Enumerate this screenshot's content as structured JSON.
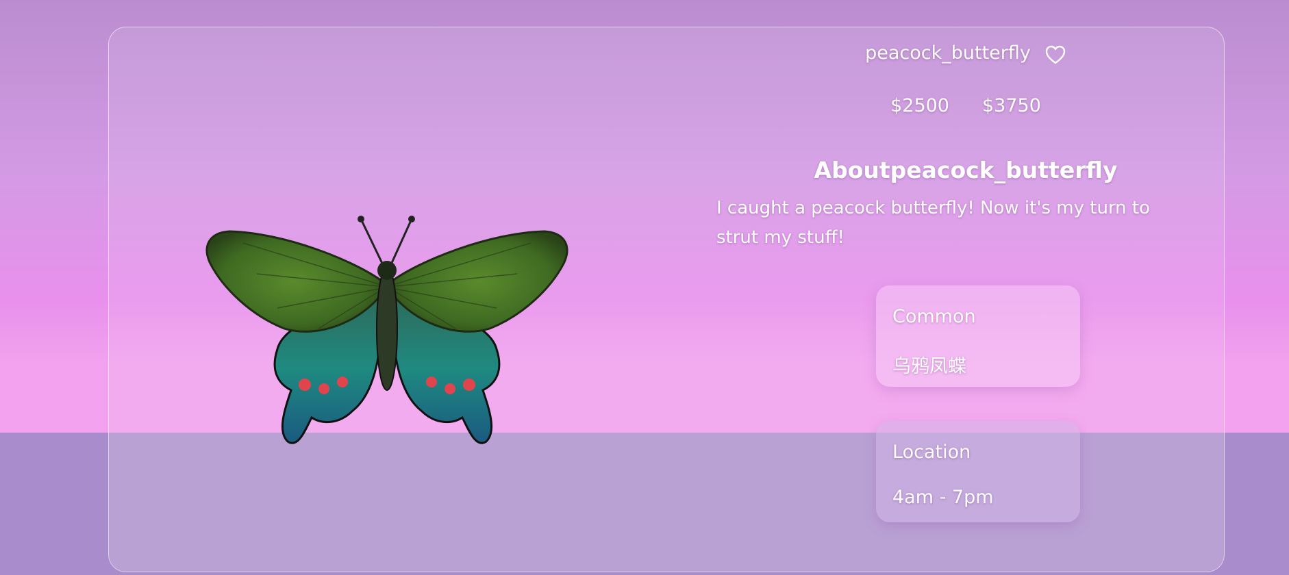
{
  "item": {
    "name": "peacock_butterfly",
    "price_sell": "$2500",
    "price_cj": "$3750",
    "about_title": "Aboutpeacock_butterfly",
    "description": "I caught a peacock butterfly! Now it's my turn to strut my stuff!"
  },
  "rarity": {
    "label": "Common",
    "localized_name": "乌鸦凤蝶"
  },
  "location": {
    "label": "Location",
    "time": "4am - 7pm"
  },
  "icons": {
    "favorite": "heart-outline-icon"
  },
  "colors": {
    "text": "#ffffff",
    "background_top": "#bb8dd0",
    "background_mid": "#f0a0ee",
    "floor": "#a98ccb"
  }
}
